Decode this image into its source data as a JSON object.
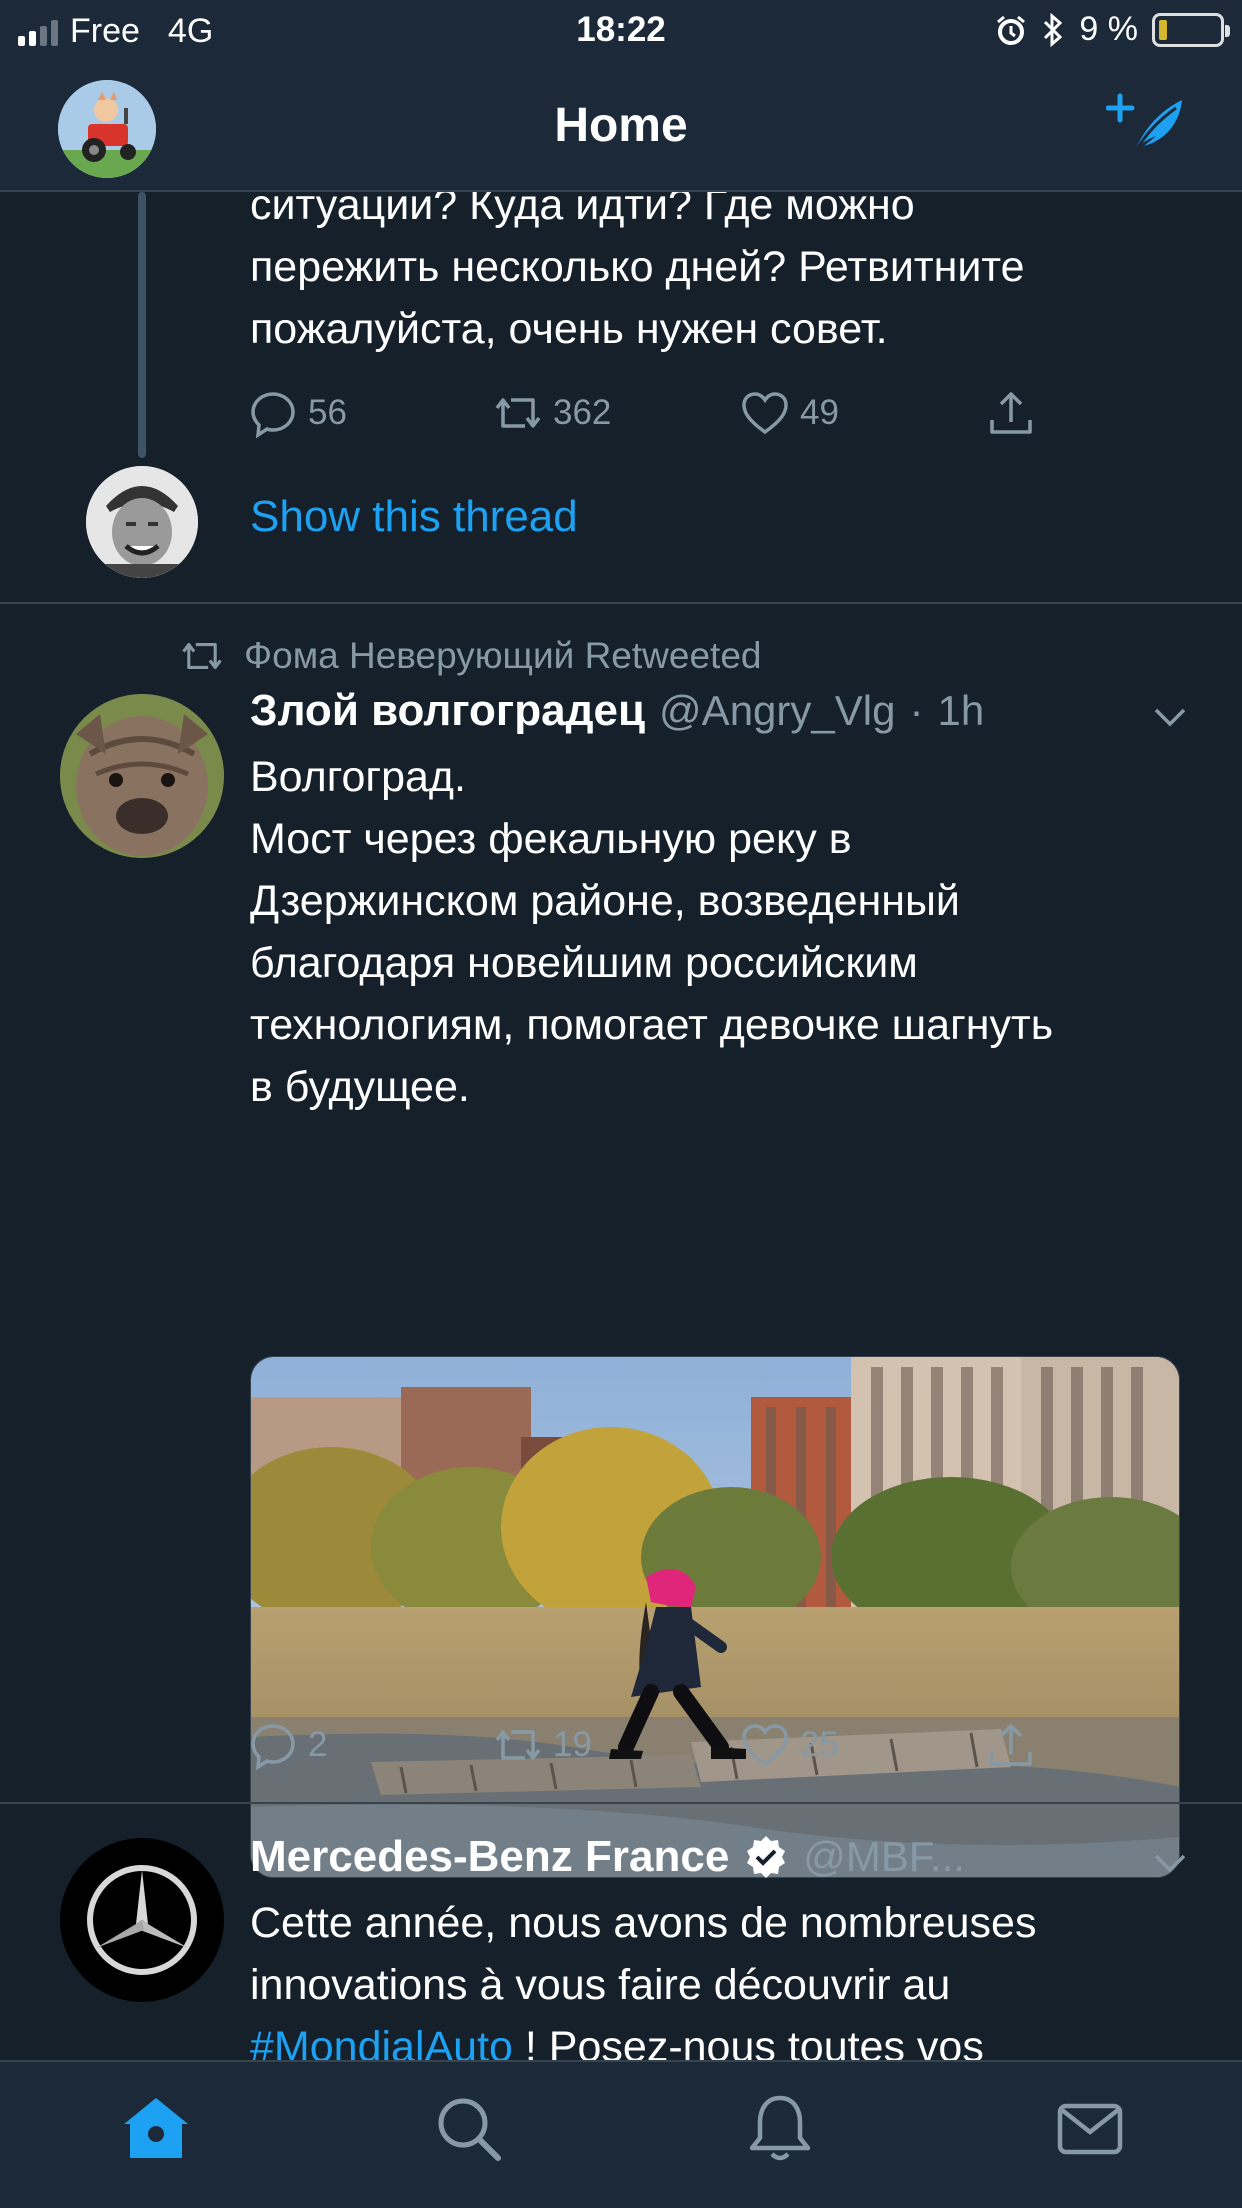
{
  "status_bar": {
    "carrier": "Free",
    "network": "4G",
    "time": "18:22",
    "battery": "9 %",
    "battery_level": 0.09
  },
  "header": {
    "title": "Home"
  },
  "thread_tweet": {
    "text_lines": [
      "ситуации? Куда идти? Где можно",
      "пережить несколько дней? Ретвитните",
      "пожалуйста, очень нужен совет."
    ],
    "replies": "56",
    "retweets": "362",
    "likes": "49",
    "show_thread": "Show this thread"
  },
  "retweet_tweet": {
    "retweeted_by": "Фома Неверующий Retweeted",
    "name": "Злой волгоградец",
    "handle": "@Angry_Vlg",
    "separator": "·",
    "time": "1h",
    "text_lines": [
      "Волгоград.",
      "Мост через фекальную реку в",
      "Дзержинском районе, возведенный",
      "благодаря новейшим российским",
      "технологиям, помогает девочке шагнуть",
      "в будущее."
    ],
    "replies": "2",
    "retweets": "19",
    "likes": "25"
  },
  "promo_tweet": {
    "name": "Mercedes-Benz France",
    "handle": "@MBF...",
    "text_line1": "Cette année, nous avons de nombreuses",
    "text_line2": "innovations à vous faire découvrir au",
    "hashtag": "#MondialAuto",
    "text_line3_rest": " ! Posez-nous toutes vos"
  },
  "tabbar": {
    "items": [
      "home-icon",
      "search-icon",
      "notifications-icon",
      "messages-icon"
    ]
  },
  "colors": {
    "background": "#15202b",
    "bar": "#1c2938",
    "accent": "#1da1f2",
    "muted": "#8899a6",
    "divider": "#38444d"
  }
}
